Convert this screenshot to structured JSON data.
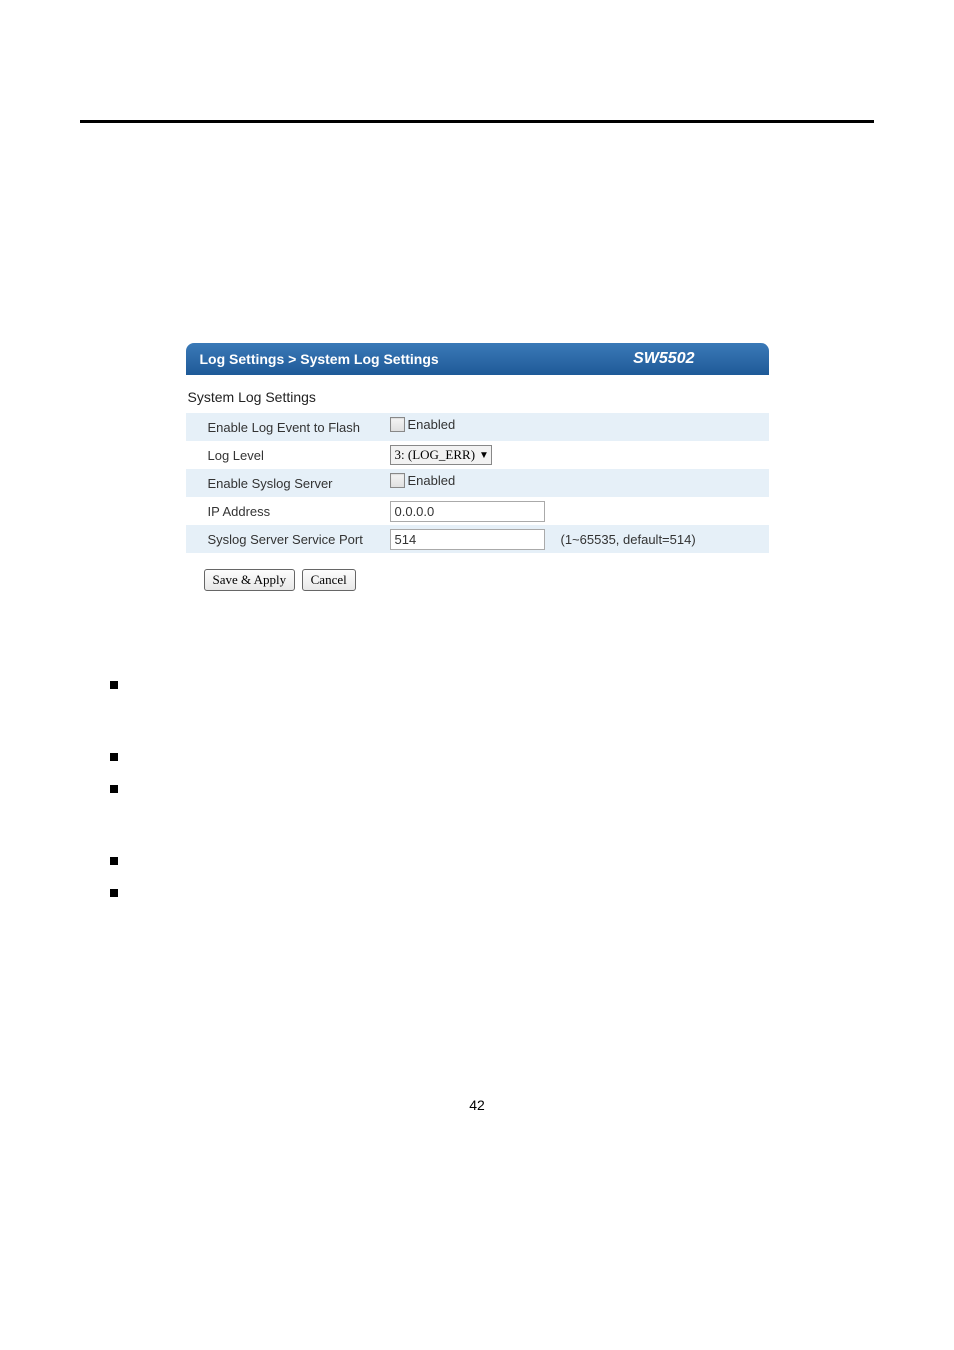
{
  "header": {
    "breadcrumb": "Log Settings > System Log Settings",
    "model": "SW5502"
  },
  "section_title": "System Log Settings",
  "rows": {
    "enable_flash": {
      "label": "Enable Log Event to Flash",
      "checkbox_label": "Enabled",
      "checked": false
    },
    "log_level": {
      "label": "Log Level",
      "value": "3: (LOG_ERR)"
    },
    "enable_syslog": {
      "label": "Enable Syslog Server",
      "checkbox_label": "Enabled",
      "checked": false
    },
    "ip_address": {
      "label": "IP Address",
      "value": "0.0.0.0"
    },
    "service_port": {
      "label": "Syslog Server Service Port",
      "value": "514",
      "note": "(1~65535, default=514)"
    }
  },
  "buttons": {
    "save": "Save & Apply",
    "cancel": "Cancel"
  },
  "page_number": "42"
}
